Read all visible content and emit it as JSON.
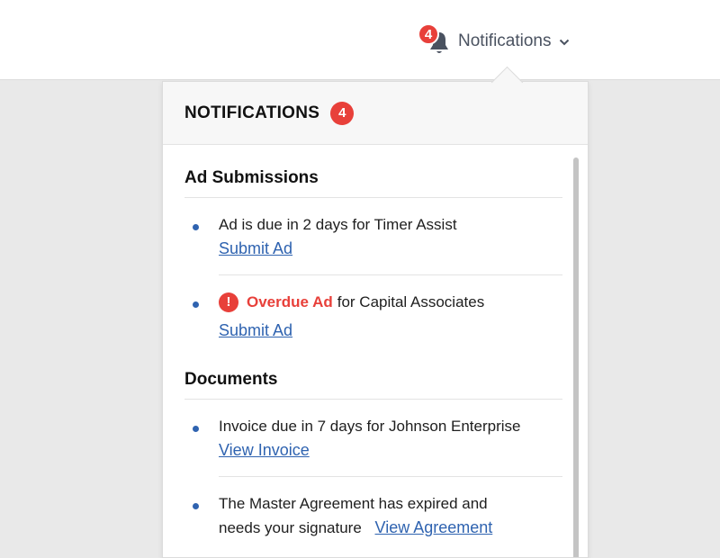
{
  "header": {
    "badge_count": "4",
    "notifications_label": "Notifications",
    "icons": {
      "bell": "bell-icon",
      "chevron": "chevron-down-icon"
    }
  },
  "panel": {
    "title": "NOTIFICATIONS",
    "count": "4",
    "sections": [
      {
        "title": "Ad Submissions",
        "items": [
          {
            "text": "Ad is due in 2 days for Timer Assist",
            "link": "Submit Ad"
          },
          {
            "alert_glyph": "!",
            "highlight": "Overdue Ad",
            "text": "for Capital Associates",
            "link": "Submit Ad"
          }
        ]
      },
      {
        "title": "Documents",
        "items": [
          {
            "text": "Invoice due in 7 days for Johnson Enterprise",
            "link": "View Invoice"
          },
          {
            "text_line1": "The Master Agreement has expired and",
            "text_line2": "needs your signature",
            "link": "View Agreement"
          }
        ]
      }
    ]
  },
  "colors": {
    "accent_red": "#e8403a",
    "link_blue": "#2f63b0",
    "background": "#e9e9e9"
  }
}
